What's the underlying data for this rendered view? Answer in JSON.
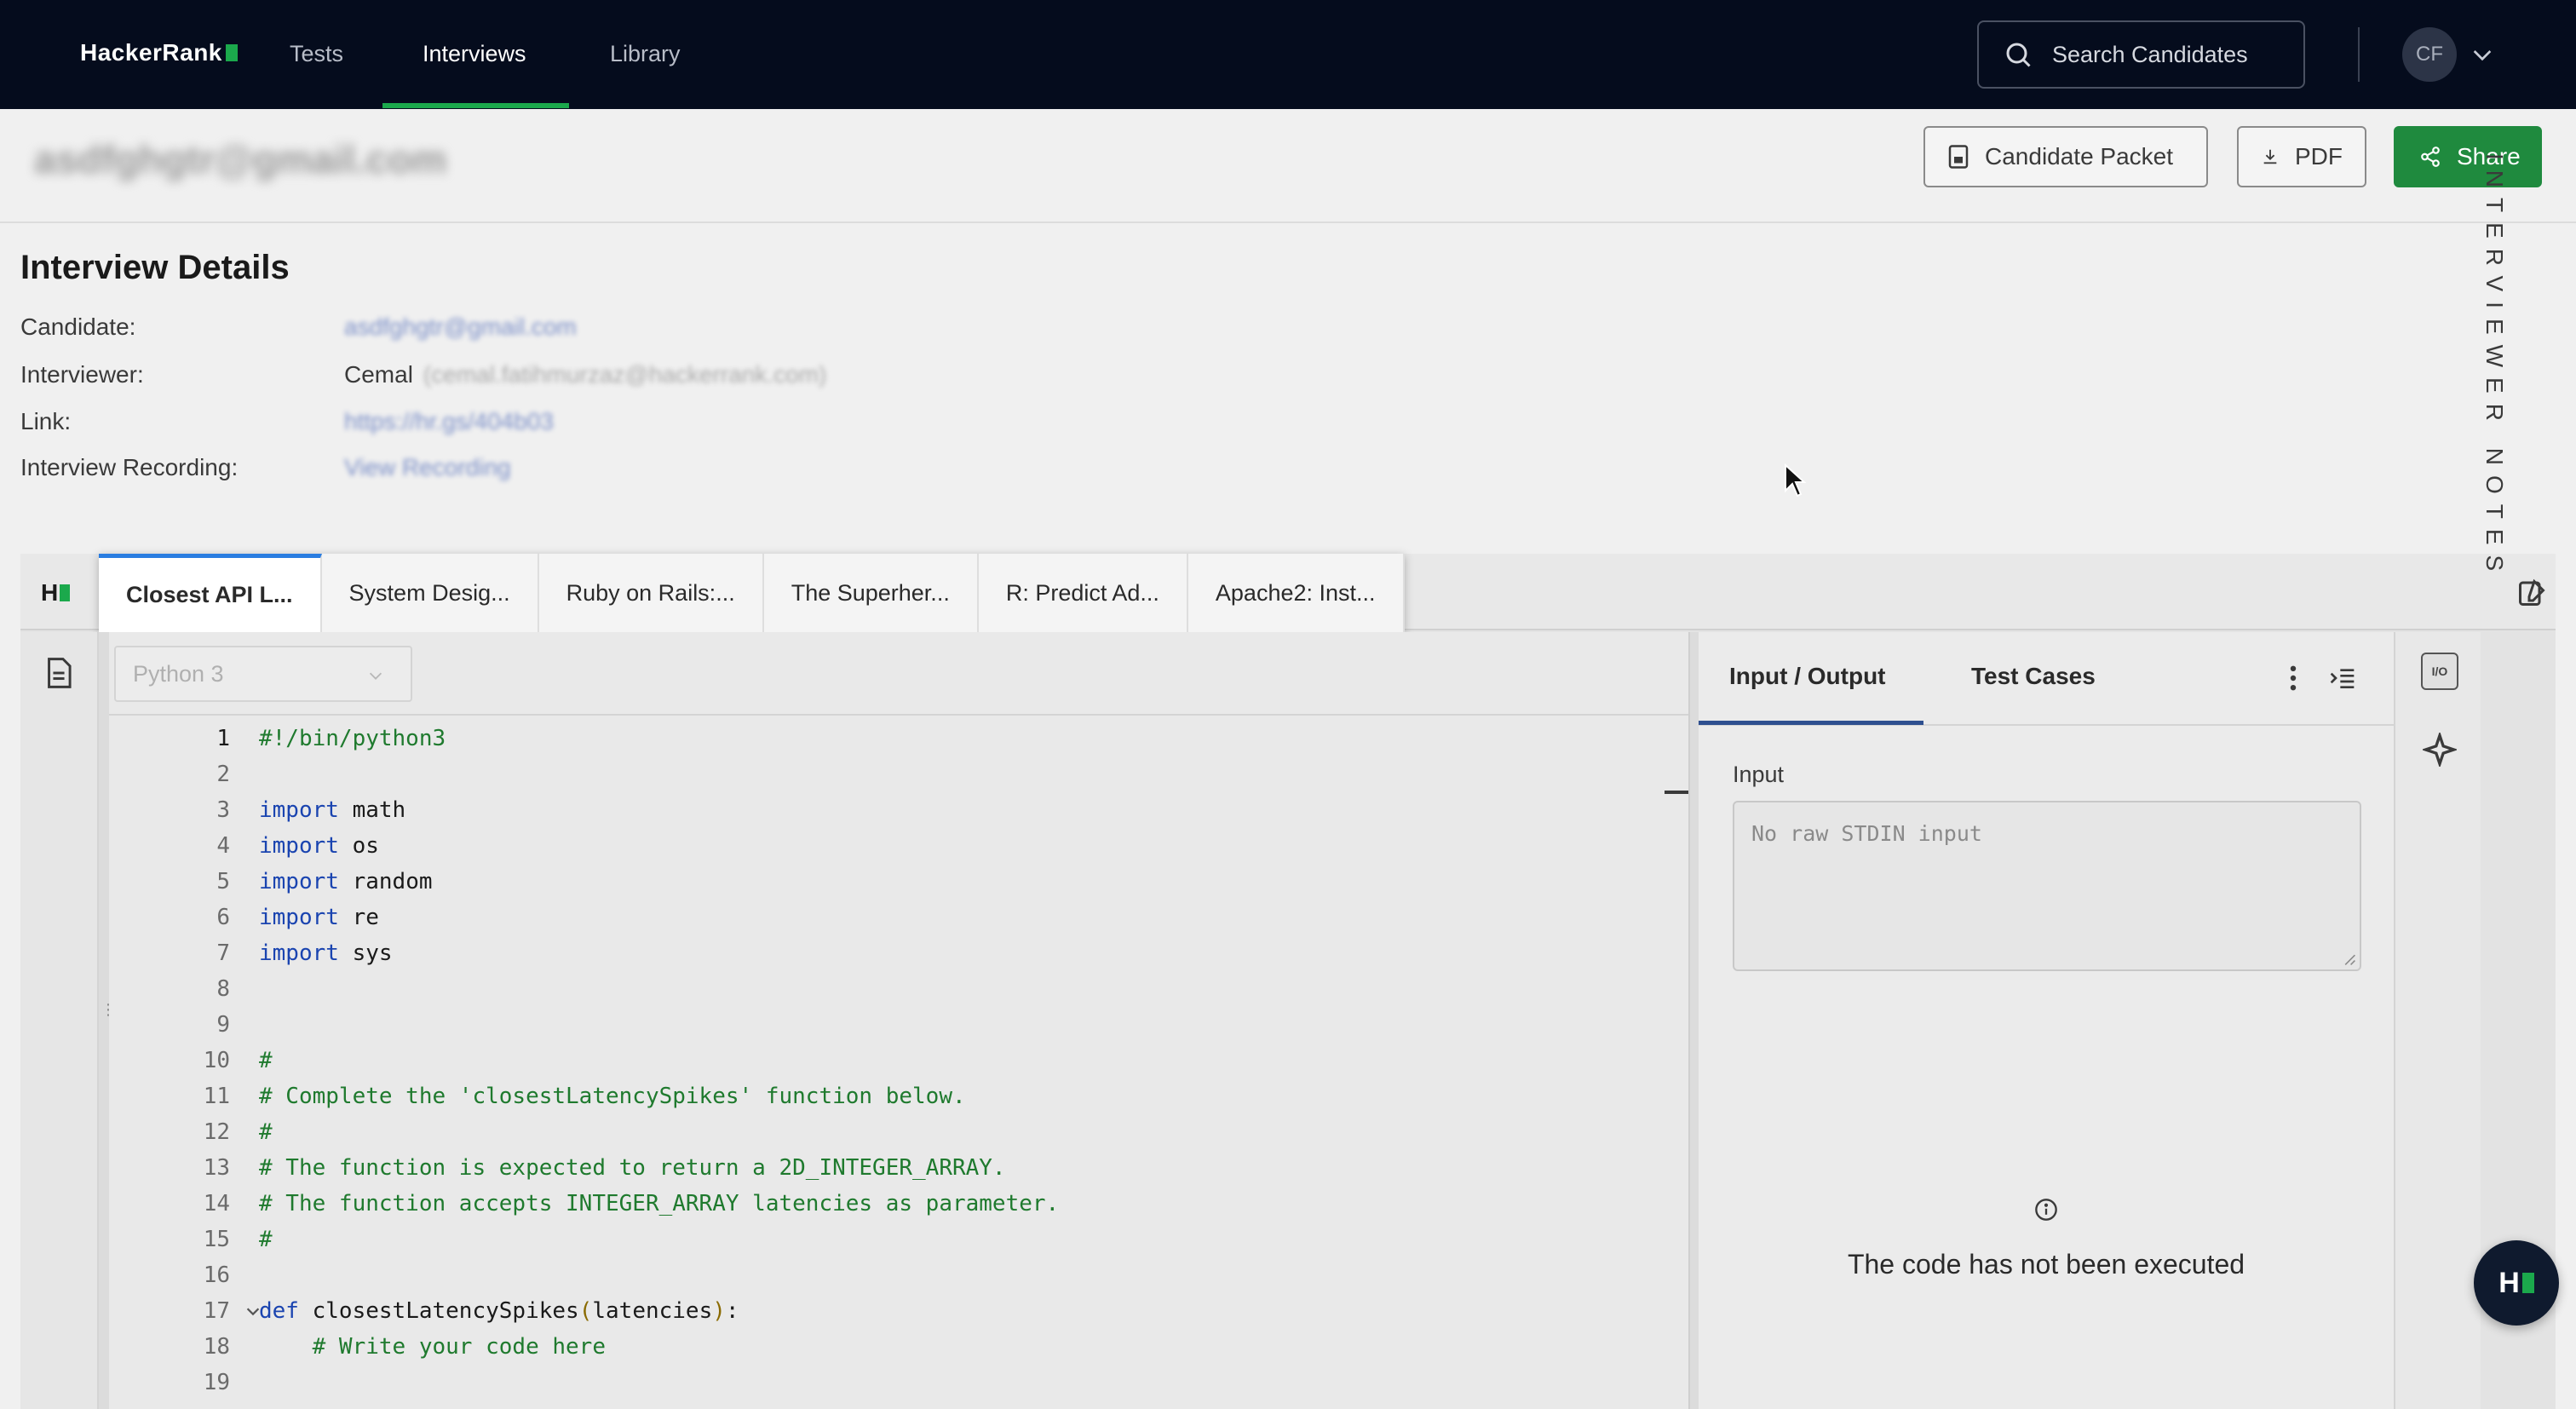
{
  "nav": {
    "brand": "HackerRank",
    "items": [
      "Tests",
      "Interviews",
      "Library"
    ],
    "active": "Interviews",
    "search_label": "Search Candidates",
    "avatar_initials": "CF"
  },
  "header": {
    "candidate_email_blurred": "asdfghgtr@gmail.com",
    "candidate_packet_label": "Candidate Packet",
    "pdf_label": "PDF",
    "share_label": "Share"
  },
  "details": {
    "title": "Interview Details",
    "rows": [
      {
        "label": "Candidate:",
        "value": "",
        "blurred": "asdfghgtr@gmail.com"
      },
      {
        "label": "Interviewer:",
        "value": "Cemal",
        "blurred": "(cemal.fatihmurzaz@hackerrank.com)"
      },
      {
        "label": "Link:",
        "value": "",
        "blurred": "https://hr.gs/404b03"
      },
      {
        "label": "Interview Recording:",
        "value": "",
        "blurred": "View Recording"
      }
    ]
  },
  "editor": {
    "tabs": [
      "Closest API L...",
      "System Desig...",
      "Ruby on Rails:...",
      "The Superher...",
      "R: Predict Ad...",
      "Apache2: Inst..."
    ],
    "active_tab": 0,
    "language": "Python 3",
    "code_lines": [
      {
        "n": "1",
        "parts": [
          {
            "t": "#!/bin/python3",
            "c": "cm"
          }
        ]
      },
      {
        "n": "2",
        "parts": []
      },
      {
        "n": "3",
        "parts": [
          {
            "t": "import",
            "c": "kw"
          },
          {
            "t": " math",
            "c": ""
          }
        ]
      },
      {
        "n": "4",
        "parts": [
          {
            "t": "import",
            "c": "kw"
          },
          {
            "t": " os",
            "c": ""
          }
        ]
      },
      {
        "n": "5",
        "parts": [
          {
            "t": "import",
            "c": "kw"
          },
          {
            "t": " random",
            "c": ""
          }
        ]
      },
      {
        "n": "6",
        "parts": [
          {
            "t": "import",
            "c": "kw"
          },
          {
            "t": " re",
            "c": ""
          }
        ]
      },
      {
        "n": "7",
        "parts": [
          {
            "t": "import",
            "c": "kw"
          },
          {
            "t": " sys",
            "c": ""
          }
        ]
      },
      {
        "n": "8",
        "parts": []
      },
      {
        "n": "9",
        "parts": []
      },
      {
        "n": "10",
        "parts": [
          {
            "t": "#",
            "c": "cm"
          }
        ]
      },
      {
        "n": "11",
        "parts": [
          {
            "t": "# Complete the 'closestLatencySpikes' function below.",
            "c": "cm"
          }
        ]
      },
      {
        "n": "12",
        "parts": [
          {
            "t": "#",
            "c": "cm"
          }
        ]
      },
      {
        "n": "13",
        "parts": [
          {
            "t": "# The function is expected to return a 2D_INTEGER_ARRAY.",
            "c": "cm"
          }
        ]
      },
      {
        "n": "14",
        "parts": [
          {
            "t": "# The function accepts INTEGER_ARRAY latencies as parameter.",
            "c": "cm"
          }
        ]
      },
      {
        "n": "15",
        "parts": [
          {
            "t": "#",
            "c": "cm"
          }
        ]
      },
      {
        "n": "16",
        "parts": []
      },
      {
        "n": "17",
        "parts": [
          {
            "t": "def",
            "c": "kw"
          },
          {
            "t": " closestLatencySpikes",
            "c": ""
          },
          {
            "t": "(",
            "c": "paren"
          },
          {
            "t": "latencies",
            "c": ""
          },
          {
            "t": ")",
            "c": "paren"
          },
          {
            "t": ":",
            "c": ""
          }
        ],
        "fold": true
      },
      {
        "n": "18",
        "parts": [
          {
            "t": "    # Write your code here",
            "c": "cm"
          }
        ]
      },
      {
        "n": "19",
        "parts": []
      }
    ]
  },
  "io": {
    "tabs": [
      "Input / Output",
      "Test Cases"
    ],
    "input_label": "Input",
    "input_placeholder": "No raw STDIN input",
    "status": "The code has not been executed"
  },
  "right_rail": {
    "io_icon_text": "I/O",
    "notes_label": "INTERVIEWER NOTES"
  },
  "fab_label": "H"
}
